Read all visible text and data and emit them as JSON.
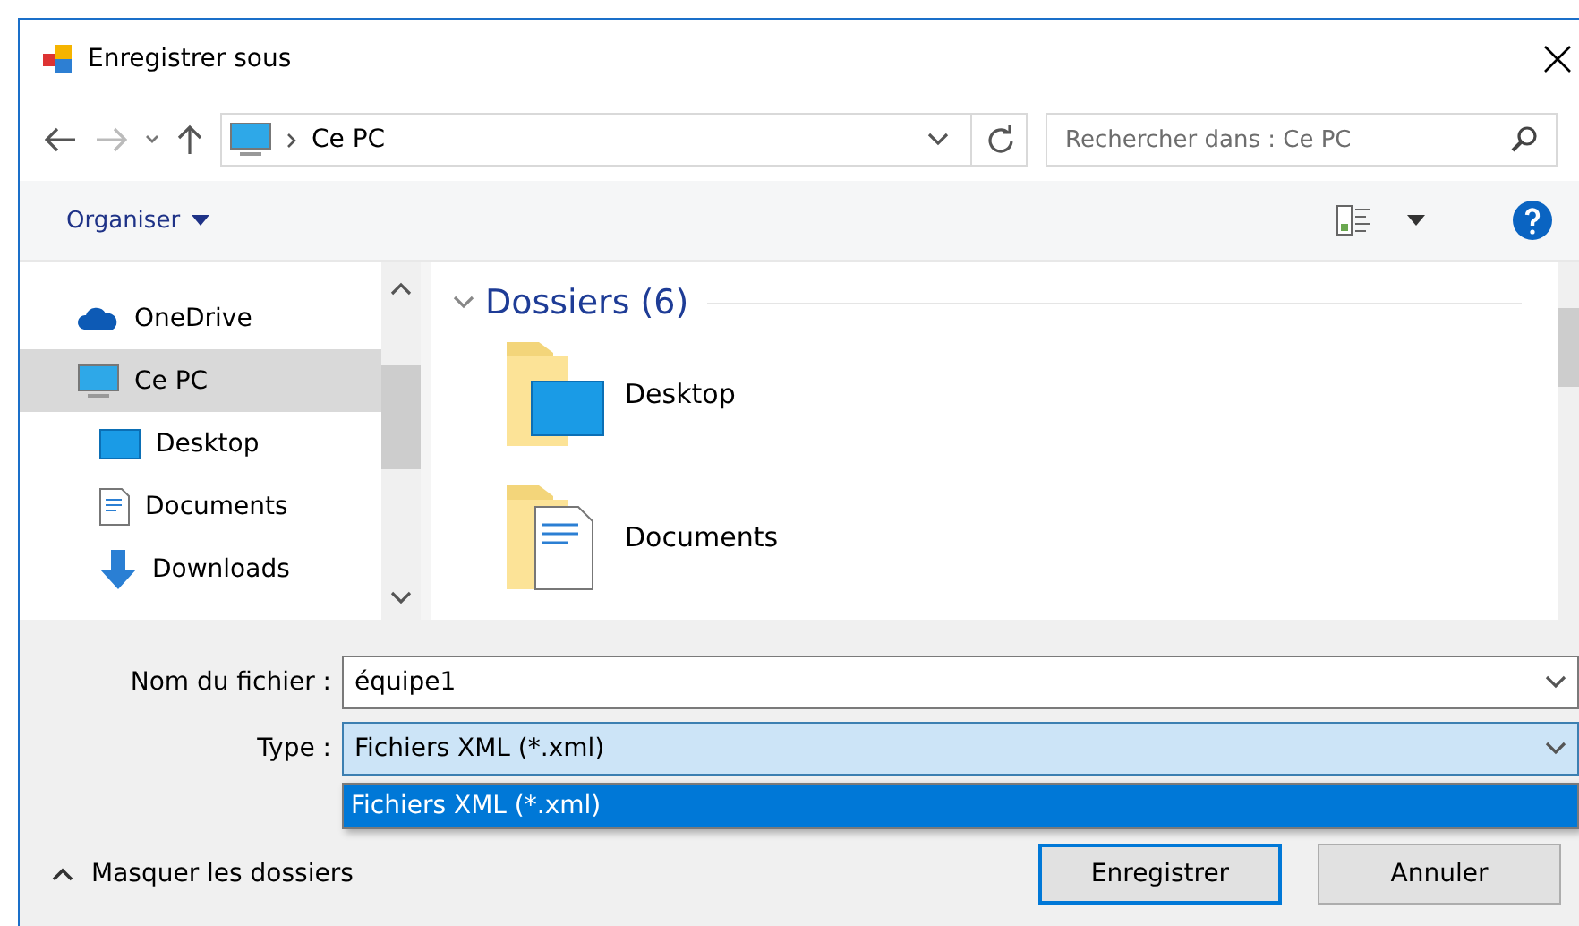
{
  "window": {
    "title": "Enregistrer sous"
  },
  "address_bar": {
    "path": [
      "Ce PC"
    ]
  },
  "search": {
    "placeholder": "Rechercher dans : Ce PC"
  },
  "toolbar": {
    "organize": "Organiser"
  },
  "nav_pane": {
    "items": [
      {
        "label": "OneDrive",
        "kind": "cloud",
        "selected": false
      },
      {
        "label": "Ce PC",
        "kind": "pc",
        "selected": true,
        "children": [
          {
            "label": "Desktop",
            "kind": "desktop",
            "selected": false
          },
          {
            "label": "Documents",
            "kind": "documents",
            "selected": false
          },
          {
            "label": "Downloads",
            "kind": "downloads",
            "selected": false
          }
        ]
      }
    ]
  },
  "content": {
    "group": {
      "title": "Dossiers (6)",
      "expanded": true
    },
    "folders": [
      {
        "label": "Desktop",
        "kind": "desktop"
      },
      {
        "label": "Documents",
        "kind": "documents"
      }
    ]
  },
  "filename": {
    "label": "Nom du fichier :",
    "value": "équipe1"
  },
  "type": {
    "label": "Type :",
    "value": "Fichiers XML (*.xml)",
    "options": [
      {
        "label": "Fichiers XML (*.xml)",
        "selected": true
      }
    ]
  },
  "hide_folders": "Masquer les dossiers",
  "buttons": [
    {
      "label": "Enregistrer",
      "default": true
    },
    {
      "label": "Annuler",
      "default": false
    }
  ]
}
